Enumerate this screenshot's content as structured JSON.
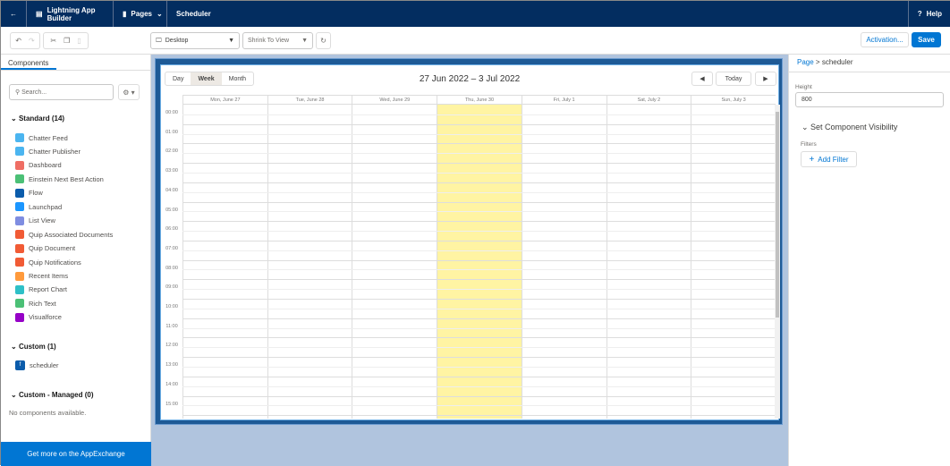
{
  "header": {
    "back_icon": "arrow-left-icon",
    "app_title": "Lightning App Builder",
    "pages_label": "Pages",
    "page_name": "Scheduler",
    "help_label": "Help"
  },
  "toolbar": {
    "device": "Desktop",
    "zoom": "Shrink To View",
    "activation_label": "Activation...",
    "save_label": "Save"
  },
  "left_panel": {
    "tab": "Components",
    "search_placeholder": "Search...",
    "standard": {
      "title": "Standard (14)",
      "items": [
        {
          "label": "Chatter Feed",
          "color": "#4bb5f0"
        },
        {
          "label": "Chatter Publisher",
          "color": "#4bb5f0"
        },
        {
          "label": "Dashboard",
          "color": "#ef6e64"
        },
        {
          "label": "Einstein Next Best Action",
          "color": "#4bc076"
        },
        {
          "label": "Flow",
          "color": "#0b5cab"
        },
        {
          "label": "Launchpad",
          "color": "#1b96ff"
        },
        {
          "label": "List View",
          "color": "#7f8de1"
        },
        {
          "label": "Quip Associated Documents",
          "color": "#f15b35"
        },
        {
          "label": "Quip Document",
          "color": "#f15b35"
        },
        {
          "label": "Quip Notifications",
          "color": "#f15b35"
        },
        {
          "label": "Recent Items",
          "color": "#ff9a3c"
        },
        {
          "label": "Report Chart",
          "color": "#2ec0c7"
        },
        {
          "label": "Rich Text",
          "color": "#4bc076"
        },
        {
          "label": "Visualforce",
          "color": "#9602c7"
        }
      ]
    },
    "custom": {
      "title": "Custom (1)",
      "items": [
        {
          "label": "scheduler",
          "color": "#0b5cab"
        }
      ]
    },
    "managed": {
      "title": "Custom - Managed (0)",
      "empty": "No components available."
    },
    "appexchange": "Get more on the AppExchange"
  },
  "calendar": {
    "views": [
      "Day",
      "Week",
      "Month"
    ],
    "active_view": "Week",
    "range": "27 Jun 2022 – 3 Jul 2022",
    "today_label": "Today",
    "days": [
      "Mon, June 27",
      "Tue, June 28",
      "Wed, June 29",
      "Thu, June 30",
      "Fri, July 1",
      "Sat, July 2",
      "Sun, July 3"
    ],
    "highlight_day": "Thu, June 30",
    "highlight_color": "#fff4a3",
    "hours": [
      "00:00",
      "01:00",
      "02:00",
      "03:00",
      "04:00",
      "05:00",
      "06:00",
      "07:00",
      "08:00",
      "09:00",
      "10:00",
      "11:00",
      "12:00",
      "13:00",
      "14:00",
      "15:00"
    ]
  },
  "right_panel": {
    "breadcrumb_page": "Page",
    "breadcrumb_sep": ">",
    "breadcrumb_current": "scheduler",
    "height_label": "Height",
    "height_value": "800",
    "visibility_title": "Set Component Visibility",
    "filters_label": "Filters",
    "add_filter": "Add Filter"
  }
}
